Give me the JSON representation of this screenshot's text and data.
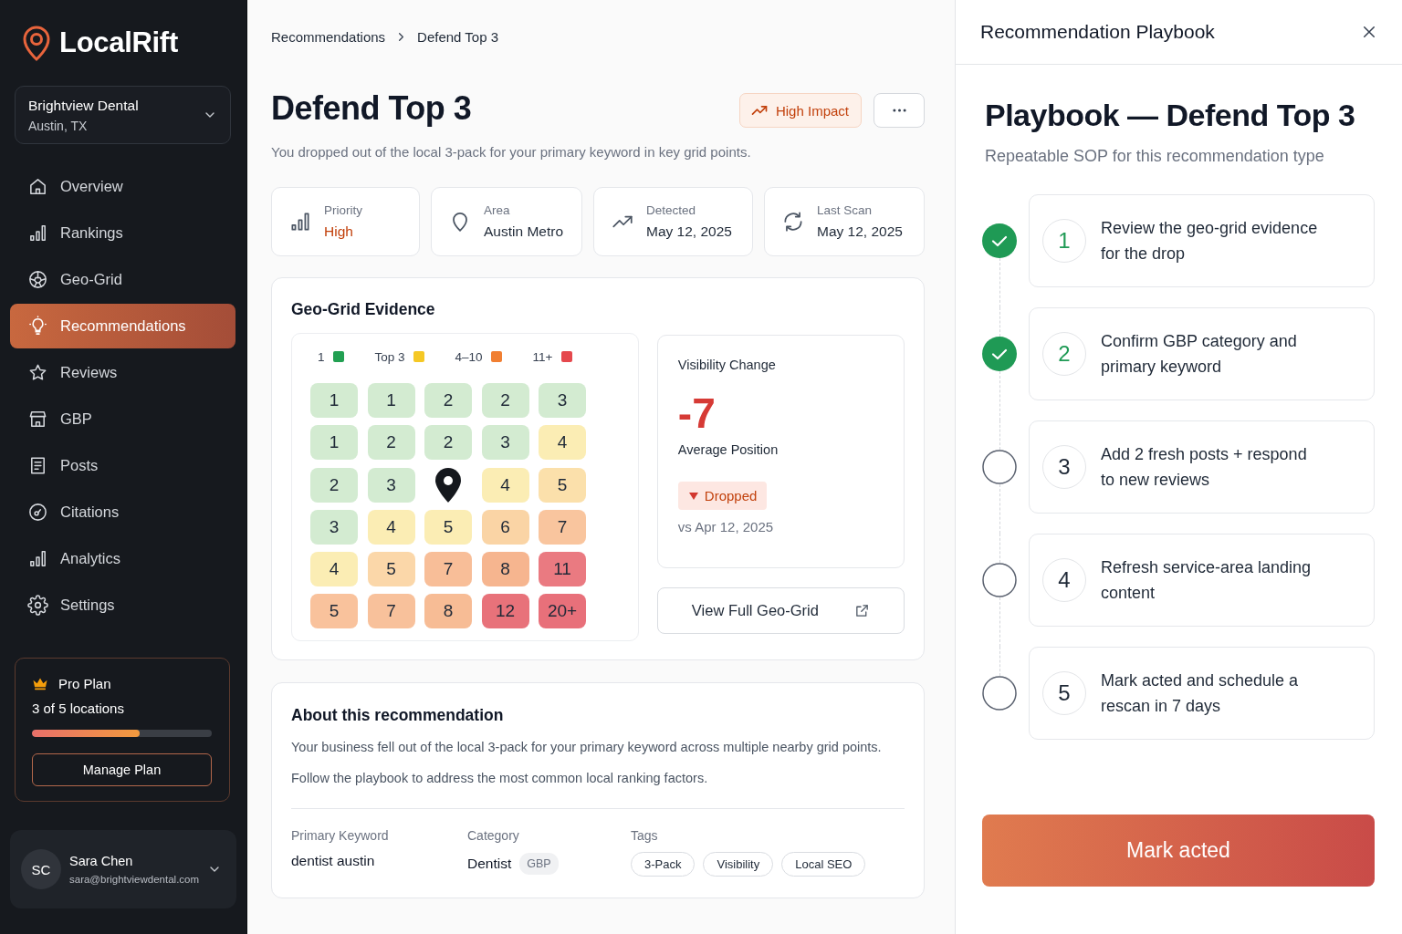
{
  "sidebar": {
    "logo": "LocalRift",
    "location": {
      "name": "Brightview Dental",
      "city": "Austin, TX"
    },
    "nav": [
      {
        "label": "Overview",
        "selected": false
      },
      {
        "label": "Rankings",
        "selected": false
      },
      {
        "label": "Geo-Grid",
        "selected": false
      },
      {
        "label": "Recommendations",
        "selected": true
      },
      {
        "label": "Reviews",
        "selected": false
      },
      {
        "label": "GBP",
        "selected": false
      },
      {
        "label": "Posts",
        "selected": false
      },
      {
        "label": "Citations",
        "selected": false
      },
      {
        "label": "Analytics",
        "selected": false
      },
      {
        "label": "Settings",
        "selected": false
      }
    ],
    "plan": {
      "name": "Pro Plan",
      "usage": "3 of 5 locations",
      "level": 0.6,
      "button": "Manage Plan"
    },
    "user": {
      "initials": "SC",
      "name": "Sara Chen",
      "email": "sara@brightviewdental.com"
    }
  },
  "breadcrumb": [
    "Recommendations",
    "Defend Top 3"
  ],
  "header": {
    "title": "Defend Top 3",
    "badge": "High Impact",
    "subtitle": "You dropped out of the local 3-pack for your primary keyword in key grid points."
  },
  "stats": [
    {
      "label": "Priority",
      "value": "High",
      "highlight": true
    },
    {
      "label": "Area",
      "value": "Austin Metro",
      "highlight": false
    },
    {
      "label": "Detected",
      "value": "May 12, 2025",
      "highlight": false
    },
    {
      "label": "Last Scan",
      "value": "May 12, 2025",
      "highlight": false
    }
  ],
  "geo_grid": {
    "title": "Geo-Grid Evidence",
    "legend": [
      {
        "label": "1",
        "color": "#22a052"
      },
      {
        "label": "Top 3",
        "color": "#f5c825"
      },
      {
        "label": "4–10",
        "color": "#f17f32"
      },
      {
        "label": "11+",
        "color": "#e5484d"
      }
    ],
    "rows": [
      {
        "cells": [
          {
            "kind": "rank",
            "value": "1",
            "color": "#d3ebd1"
          },
          {
            "kind": "rank",
            "value": "1",
            "color": "#d3ebd1"
          },
          {
            "kind": "rank",
            "value": "2",
            "color": "#d3ebd1"
          },
          {
            "kind": "rank",
            "value": "2",
            "color": "#d3ebd1"
          },
          {
            "kind": "rank",
            "value": "3",
            "color": "#d3ebd1"
          }
        ]
      },
      {
        "cells": [
          {
            "kind": "rank",
            "value": "1",
            "color": "#d3ebd1"
          },
          {
            "kind": "rank",
            "value": "2",
            "color": "#d3ebd1"
          },
          {
            "kind": "rank",
            "value": "2",
            "color": "#d3ebd1"
          },
          {
            "kind": "rank",
            "value": "3",
            "color": "#d3ebd1"
          },
          {
            "kind": "rank",
            "value": "4",
            "color": "#fbedb4"
          }
        ]
      },
      {
        "cells": [
          {
            "kind": "rank",
            "value": "2",
            "color": "#d3ebd1"
          },
          {
            "kind": "rank",
            "value": "3",
            "color": "#d3ebd1"
          },
          {
            "kind": "pin"
          },
          {
            "kind": "rank",
            "value": "4",
            "color": "#fbedb4"
          },
          {
            "kind": "rank",
            "value": "5",
            "color": "#fbe0ab"
          }
        ]
      },
      {
        "cells": [
          {
            "kind": "rank",
            "value": "3",
            "color": "#d3ebd1"
          },
          {
            "kind": "rank",
            "value": "4",
            "color": "#fbedb4"
          },
          {
            "kind": "rank",
            "value": "5",
            "color": "#fbedb4"
          },
          {
            "kind": "rank",
            "value": "6",
            "color": "#fad4a5"
          },
          {
            "kind": "rank",
            "value": "7",
            "color": "#f9c59e"
          }
        ]
      },
      {
        "cells": [
          {
            "kind": "rank",
            "value": "4",
            "color": "#fbedb4"
          },
          {
            "kind": "rank",
            "value": "5",
            "color": "#fbd7a9"
          },
          {
            "kind": "rank",
            "value": "7",
            "color": "#f8be98"
          },
          {
            "kind": "rank",
            "value": "8",
            "color": "#f6b58f"
          },
          {
            "kind": "rank",
            "value": "11",
            "color": "#ea7a81"
          }
        ]
      },
      {
        "cells": [
          {
            "kind": "rank",
            "value": "5",
            "color": "#f9c29c"
          },
          {
            "kind": "rank",
            "value": "7",
            "color": "#f8c19b"
          },
          {
            "kind": "rank",
            "value": "8",
            "color": "#f7bc95"
          },
          {
            "kind": "rank",
            "value": "12",
            "color": "#e8727a"
          },
          {
            "kind": "rank",
            "value": "20+",
            "color": "#e8707a"
          }
        ]
      }
    ],
    "visibility": {
      "title": "Visibility Change",
      "value": "-7",
      "label": "Average Position",
      "badge": "Dropped",
      "compare": "vs Apr 12, 2025"
    },
    "view_button": "View Full Geo-Grid"
  },
  "about": {
    "title": "About this recommendation",
    "paragraphs": [
      "Your business fell out of the local 3-pack for your primary keyword across multiple nearby grid points.",
      "Follow the playbook to address the most common local ranking factors."
    ],
    "keyword": {
      "label": "Primary Keyword",
      "value": "dentist austin"
    },
    "category": {
      "label": "Category",
      "value": "Dentist",
      "badge": "GBP"
    },
    "tags": {
      "label": "Tags",
      "items": [
        "3-Pack",
        "Visibility",
        "Local SEO"
      ]
    }
  },
  "playbook": {
    "header": "Recommendation Playbook",
    "title": "Playbook — Defend Top 3",
    "subtitle": "Repeatable SOP for this recommendation type",
    "steps": [
      {
        "number": "1",
        "text": "Review the geo-grid evidence for the drop",
        "checked": true
      },
      {
        "number": "2",
        "text": "Confirm GBP category and primary keyword",
        "checked": true
      },
      {
        "number": "3",
        "text": "Add 2 fresh posts + respond to new reviews",
        "checked": false
      },
      {
        "number": "4",
        "text": "Refresh service-area landing content",
        "checked": false
      },
      {
        "number": "5",
        "text": "Mark acted and schedule a rescan in 7 days",
        "checked": false
      }
    ],
    "button": "Mark acted"
  }
}
